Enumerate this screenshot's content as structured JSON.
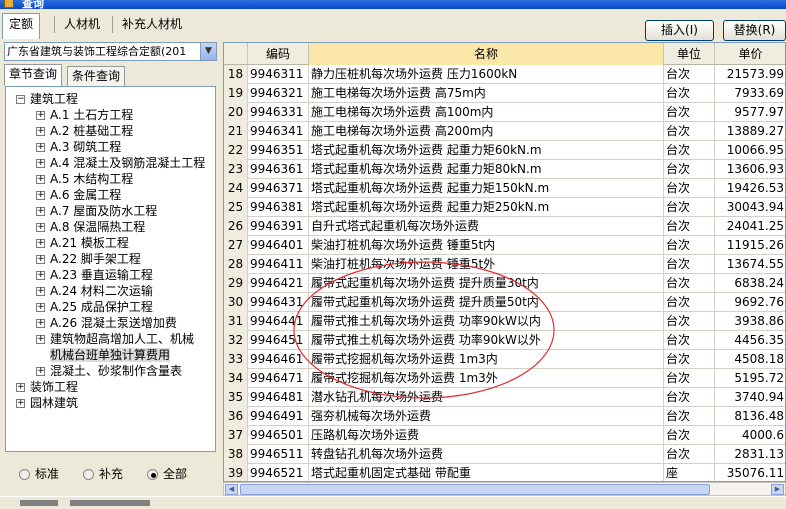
{
  "window": {
    "title": "查询"
  },
  "top_tabs": [
    "定额",
    "人材机",
    "补充人材机"
  ],
  "buttons": {
    "insert": "插入(I)",
    "replace": "替换(R)"
  },
  "quota_combo": {
    "value": "广东省建筑与装饰工程综合定额(201"
  },
  "left_tabs": [
    "章节查询",
    "条件查询"
  ],
  "tree": [
    {
      "label": "建筑工程",
      "toggle": "−"
    },
    {
      "label": "A.1 土石方工程",
      "toggle": "+"
    },
    {
      "label": "A.2 桩基础工程",
      "toggle": "+"
    },
    {
      "label": "A.3 砌筑工程",
      "toggle": "+"
    },
    {
      "label": "A.4 混凝土及钢筋混凝土工程",
      "toggle": "+"
    },
    {
      "label": "A.5 木结构工程",
      "toggle": "+"
    },
    {
      "label": "A.6 金属工程",
      "toggle": "+"
    },
    {
      "label": "A.7 屋面及防水工程",
      "toggle": "+"
    },
    {
      "label": "A.8 保温隔热工程",
      "toggle": "+"
    },
    {
      "label": "A.21 模板工程",
      "toggle": "+"
    },
    {
      "label": "A.22 脚手架工程",
      "toggle": "+"
    },
    {
      "label": "A.23 垂直运输工程",
      "toggle": "+"
    },
    {
      "label": "A.24 材料二次运输",
      "toggle": "+"
    },
    {
      "label": "A.25 成品保护工程",
      "toggle": "+"
    },
    {
      "label": "A.26 混凝土泵送增加费",
      "toggle": "+"
    },
    {
      "label": "建筑物超高增加人工、机械",
      "toggle": "+"
    },
    {
      "label": "机械台班单独计算费用",
      "toggle": ""
    },
    {
      "label": "混凝土、砂浆制作含量表",
      "toggle": "+"
    },
    {
      "label": "装饰工程",
      "toggle": "+"
    },
    {
      "label": "园林建筑",
      "toggle": "+"
    }
  ],
  "filter_radios": {
    "options": [
      "标准",
      "补充",
      "全部"
    ],
    "selected": "全部"
  },
  "table": {
    "headers": [
      "",
      "编码",
      "名称",
      "单位",
      "单价"
    ],
    "rows": [
      [
        "18",
        "9946311",
        "静力压桩机每次场外运费 压力1600kN",
        "台次",
        "21573.99"
      ],
      [
        "19",
        "9946321",
        "施工电梯每次场外运费 高75m内",
        "台次",
        "7933.69"
      ],
      [
        "20",
        "9946331",
        "施工电梯每次场外运费 高100m内",
        "台次",
        "9577.97"
      ],
      [
        "21",
        "9946341",
        "施工电梯每次场外运费 高200m内",
        "台次",
        "13889.27"
      ],
      [
        "22",
        "9946351",
        "塔式起重机每次场外运费 起重力矩60kN.m",
        "台次",
        "10066.95"
      ],
      [
        "23",
        "9946361",
        "塔式起重机每次场外运费 起重力矩80kN.m",
        "台次",
        "13606.93"
      ],
      [
        "24",
        "9946371",
        "塔式起重机每次场外运费 起重力矩150kN.m",
        "台次",
        "19426.53"
      ],
      [
        "25",
        "9946381",
        "塔式起重机每次场外运费 起重力矩250kN.m",
        "台次",
        "30043.94"
      ],
      [
        "26",
        "9946391",
        "自升式塔式起重机每次场外运费",
        "台次",
        "24041.25"
      ],
      [
        "27",
        "9946401",
        "柴油打桩机每次场外运费 锤重5t内",
        "台次",
        "11915.26"
      ],
      [
        "28",
        "9946411",
        "柴油打桩机每次场外运费 锤重5t外",
        "台次",
        "13674.55"
      ],
      [
        "29",
        "9946421",
        "履带式起重机每次场外运费 提升质量30t内",
        "台次",
        "6838.24"
      ],
      [
        "30",
        "9946431",
        "履带式起重机每次场外运费 提升质量50t内",
        "台次",
        "9692.76"
      ],
      [
        "31",
        "9946441",
        "履带式推土机每次场外运费 功率90kW以内",
        "台次",
        "3938.86"
      ],
      [
        "32",
        "9946451",
        "履带式推土机每次场外运费 功率90kW以外",
        "台次",
        "4456.35"
      ],
      [
        "33",
        "9946461",
        "履带式挖掘机每次场外运费 1m3内",
        "台次",
        "4508.18"
      ],
      [
        "34",
        "9946471",
        "履带式挖掘机每次场外运费 1m3外",
        "台次",
        "5195.72"
      ],
      [
        "35",
        "9946481",
        "潜水钻孔机每次场外运费",
        "台次",
        "3740.94"
      ],
      [
        "36",
        "9946491",
        "强夯机械每次场外运费",
        "台次",
        "8136.48"
      ],
      [
        "37",
        "9946501",
        "压路机每次场外运费",
        "台次",
        "4000.6"
      ],
      [
        "38",
        "9946511",
        "转盘钻孔机每次场外运费",
        "台次",
        "2831.13"
      ],
      [
        "39",
        "9946521",
        "塔式起重机固定式基础 带配重",
        "座",
        "35076.11"
      ]
    ]
  },
  "colors": {
    "selected_header": "#fbe7a8",
    "annotation_ellipse": "#e03030"
  }
}
